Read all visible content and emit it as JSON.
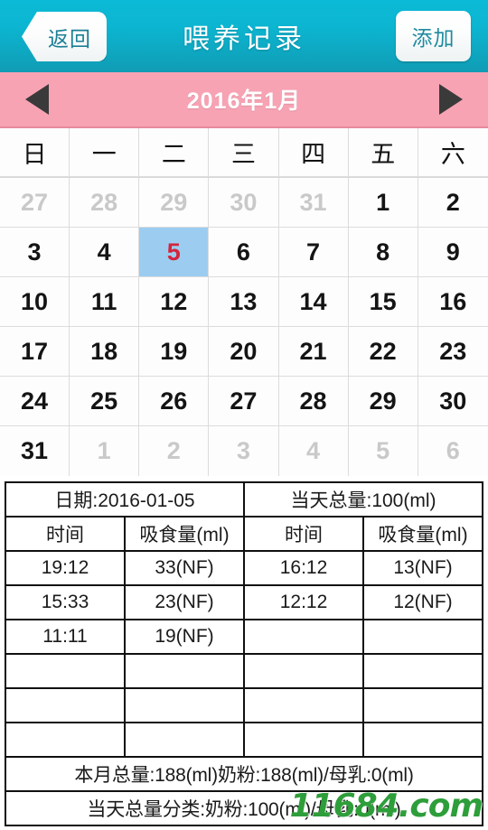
{
  "navbar": {
    "back_label": "返回",
    "title": "喂养记录",
    "add_label": "添加"
  },
  "monthbar": {
    "prev_icon": "triangle-left-icon",
    "next_icon": "triangle-right-icon",
    "month_label": "2016年1月"
  },
  "calendar": {
    "weekdays": [
      "日",
      "一",
      "二",
      "三",
      "四",
      "五",
      "六"
    ],
    "weeks": [
      [
        {
          "day": "27",
          "muted": true,
          "selected": false
        },
        {
          "day": "28",
          "muted": true,
          "selected": false
        },
        {
          "day": "29",
          "muted": true,
          "selected": false
        },
        {
          "day": "30",
          "muted": true,
          "selected": false
        },
        {
          "day": "31",
          "muted": true,
          "selected": false
        },
        {
          "day": "1",
          "muted": false,
          "selected": false
        },
        {
          "day": "2",
          "muted": false,
          "selected": false
        }
      ],
      [
        {
          "day": "3",
          "muted": false,
          "selected": false
        },
        {
          "day": "4",
          "muted": false,
          "selected": false
        },
        {
          "day": "5",
          "muted": false,
          "selected": true
        },
        {
          "day": "6",
          "muted": false,
          "selected": false
        },
        {
          "day": "7",
          "muted": false,
          "selected": false
        },
        {
          "day": "8",
          "muted": false,
          "selected": false
        },
        {
          "day": "9",
          "muted": false,
          "selected": false
        }
      ],
      [
        {
          "day": "10",
          "muted": false,
          "selected": false
        },
        {
          "day": "11",
          "muted": false,
          "selected": false
        },
        {
          "day": "12",
          "muted": false,
          "selected": false
        },
        {
          "day": "13",
          "muted": false,
          "selected": false
        },
        {
          "day": "14",
          "muted": false,
          "selected": false
        },
        {
          "day": "15",
          "muted": false,
          "selected": false
        },
        {
          "day": "16",
          "muted": false,
          "selected": false
        }
      ],
      [
        {
          "day": "17",
          "muted": false,
          "selected": false
        },
        {
          "day": "18",
          "muted": false,
          "selected": false
        },
        {
          "day": "19",
          "muted": false,
          "selected": false
        },
        {
          "day": "20",
          "muted": false,
          "selected": false
        },
        {
          "day": "21",
          "muted": false,
          "selected": false
        },
        {
          "day": "22",
          "muted": false,
          "selected": false
        },
        {
          "day": "23",
          "muted": false,
          "selected": false
        }
      ],
      [
        {
          "day": "24",
          "muted": false,
          "selected": false
        },
        {
          "day": "25",
          "muted": false,
          "selected": false
        },
        {
          "day": "26",
          "muted": false,
          "selected": false
        },
        {
          "day": "27",
          "muted": false,
          "selected": false
        },
        {
          "day": "28",
          "muted": false,
          "selected": false
        },
        {
          "day": "29",
          "muted": false,
          "selected": false
        },
        {
          "day": "30",
          "muted": false,
          "selected": false
        }
      ],
      [
        {
          "day": "31",
          "muted": false,
          "selected": false
        },
        {
          "day": "1",
          "muted": true,
          "selected": false
        },
        {
          "day": "2",
          "muted": true,
          "selected": false
        },
        {
          "day": "3",
          "muted": true,
          "selected": false
        },
        {
          "day": "4",
          "muted": true,
          "selected": false
        },
        {
          "day": "5",
          "muted": true,
          "selected": false
        },
        {
          "day": "6",
          "muted": true,
          "selected": false
        }
      ]
    ]
  },
  "record": {
    "date_text": "日期:2016-01-05",
    "day_total_text": "当天总量:100(ml)",
    "headers": [
      "时间",
      "吸食量(ml)",
      "时间",
      "吸食量(ml)"
    ],
    "rows": [
      [
        "19:12",
        "33(NF)",
        "16:12",
        "13(NF)"
      ],
      [
        "15:33",
        "23(NF)",
        "12:12",
        "12(NF)"
      ],
      [
        "11:11",
        "19(NF)",
        "",
        ""
      ],
      [
        "",
        "",
        "",
        ""
      ],
      [
        "",
        "",
        "",
        ""
      ],
      [
        "",
        "",
        "",
        ""
      ]
    ],
    "month_total_text": "本月总量:188(ml)奶粉:188(ml)/母乳:0(ml)",
    "day_breakdown_text": "当天总量分类:奶粉:100(ml)/母乳:0(ml)"
  },
  "watermark": {
    "text": "11684.com"
  },
  "colors": {
    "nav_top": "#0bbad6",
    "nav_bottom": "#109cb4",
    "pink_bar": "#f7a3b4",
    "selected_day_bg": "#9ccdf1",
    "selected_day_text": "#d4243c",
    "accent_red": "#d8304a",
    "watermark_green": "#2e9e3a"
  }
}
